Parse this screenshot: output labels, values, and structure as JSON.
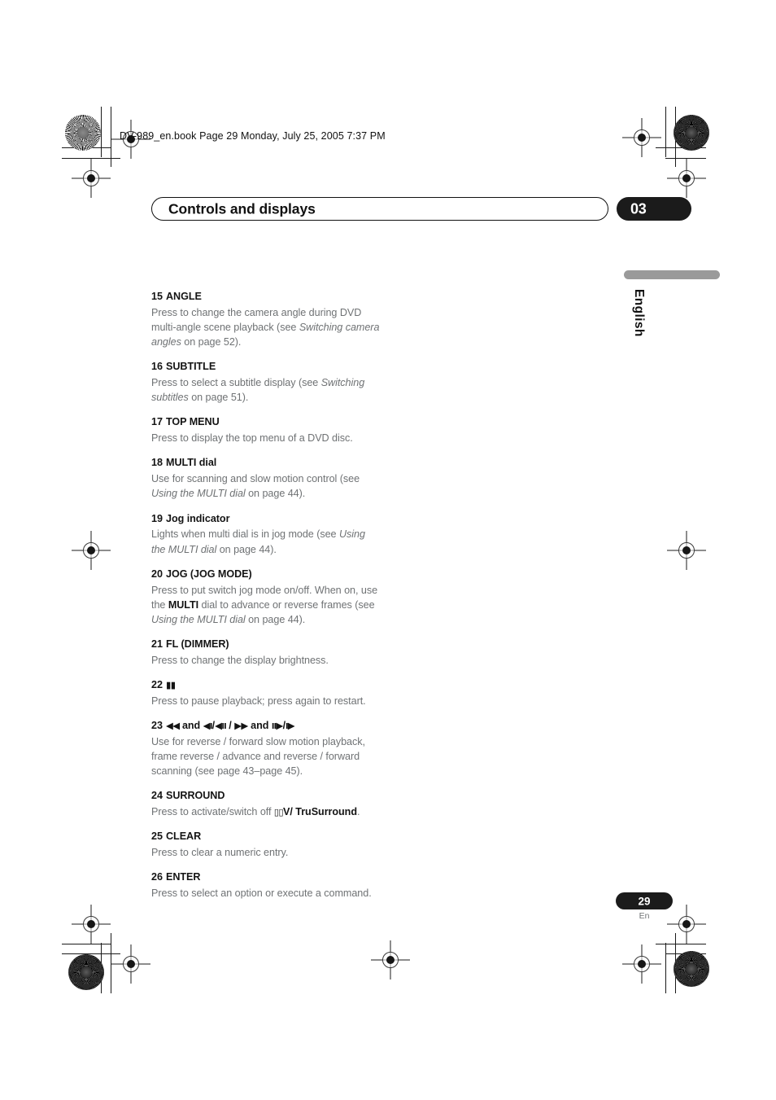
{
  "print_header": {
    "text": "DV-989_en.book  Page 29  Monday, July 25, 2005  7:37 PM"
  },
  "chapter": {
    "title": "Controls and displays",
    "number": "03"
  },
  "language_tab": {
    "label": "English"
  },
  "footer": {
    "page_number": "29",
    "language_code": "En"
  },
  "colors": {
    "heading_text": "#141414",
    "body_text": "#6f7274",
    "pill_background": "#1b1b1b",
    "pill_text": "#ffffff",
    "language_bar": "#9a9a9a"
  },
  "entries": [
    {
      "number": "15",
      "name": "ANGLE",
      "body_html": "Press to change the camera angle during DVD multi-angle scene playback (see <i>Switching camera angles</i> on page 52)."
    },
    {
      "number": "16",
      "name": "SUBTITLE",
      "body_html": "Press to select a subtitle display (see <i>Switching subtitles</i> on page 51)."
    },
    {
      "number": "17",
      "name": "TOP MENU",
      "body_html": "Press to display the top menu of a DVD disc."
    },
    {
      "number": "18",
      "name": "MULTI dial",
      "body_html": "Use for scanning and slow motion control (see <i>Using the MULTI dial</i> on page 44)."
    },
    {
      "number": "19",
      "name": "Jog indicator",
      "body_html": "Lights when multi dial is in jog mode (see <i>Using the MULTI dial</i> on page 44)."
    },
    {
      "number": "20",
      "name": "JOG (JOG MODE)",
      "body_html": "Press to put switch jog mode on/off. When on, use the <b>MULTI</b> dial to advance or reverse frames (see <i>Using the MULTI dial</i> on page 44)."
    },
    {
      "number": "21",
      "name": "FL (DIMMER)",
      "body_html": "Press to change the display brightness."
    },
    {
      "number": "22",
      "name_html": "<span class=\"glyph\">&#9646;&#9646;</span>",
      "name_icon": "pause-icon",
      "body_html": "Press to pause playback; press again to restart."
    },
    {
      "number": "23",
      "name_html": "<span class=\"glyph\">&#9664;&#9664;</span> and <span class=\"glyph\">&#9664;</span><span class=\"glyph-sm\">I</span>/<span class=\"glyph\">&#9664;</span><span class=\"glyph-sm\">II</span> / <span class=\"glyph\">&#9654;&#9654;</span> and <span class=\"glyph-sm\">II</span><span class=\"glyph\">&#9654;</span>/<span class=\"glyph-sm\">I</span><span class=\"glyph\">&#9654;</span>",
      "name_icon": "scan-and-slow-motion-icons",
      "body_html": "Use for reverse / forward slow motion playback, frame reverse / advance and reverse / forward scanning (see page 43&#8211;page 45)."
    },
    {
      "number": "24",
      "name": "SURROUND",
      "body_html": "Press to activate/switch off <span class=\"dolby\">&#9647;&#9647;</span><b>V/ TruSurround</b>."
    },
    {
      "number": "25",
      "name": "CLEAR",
      "body_html": "Press to clear a numeric entry."
    },
    {
      "number": "26",
      "name": "ENTER",
      "body_html": "Press to select an option or execute a command."
    }
  ]
}
